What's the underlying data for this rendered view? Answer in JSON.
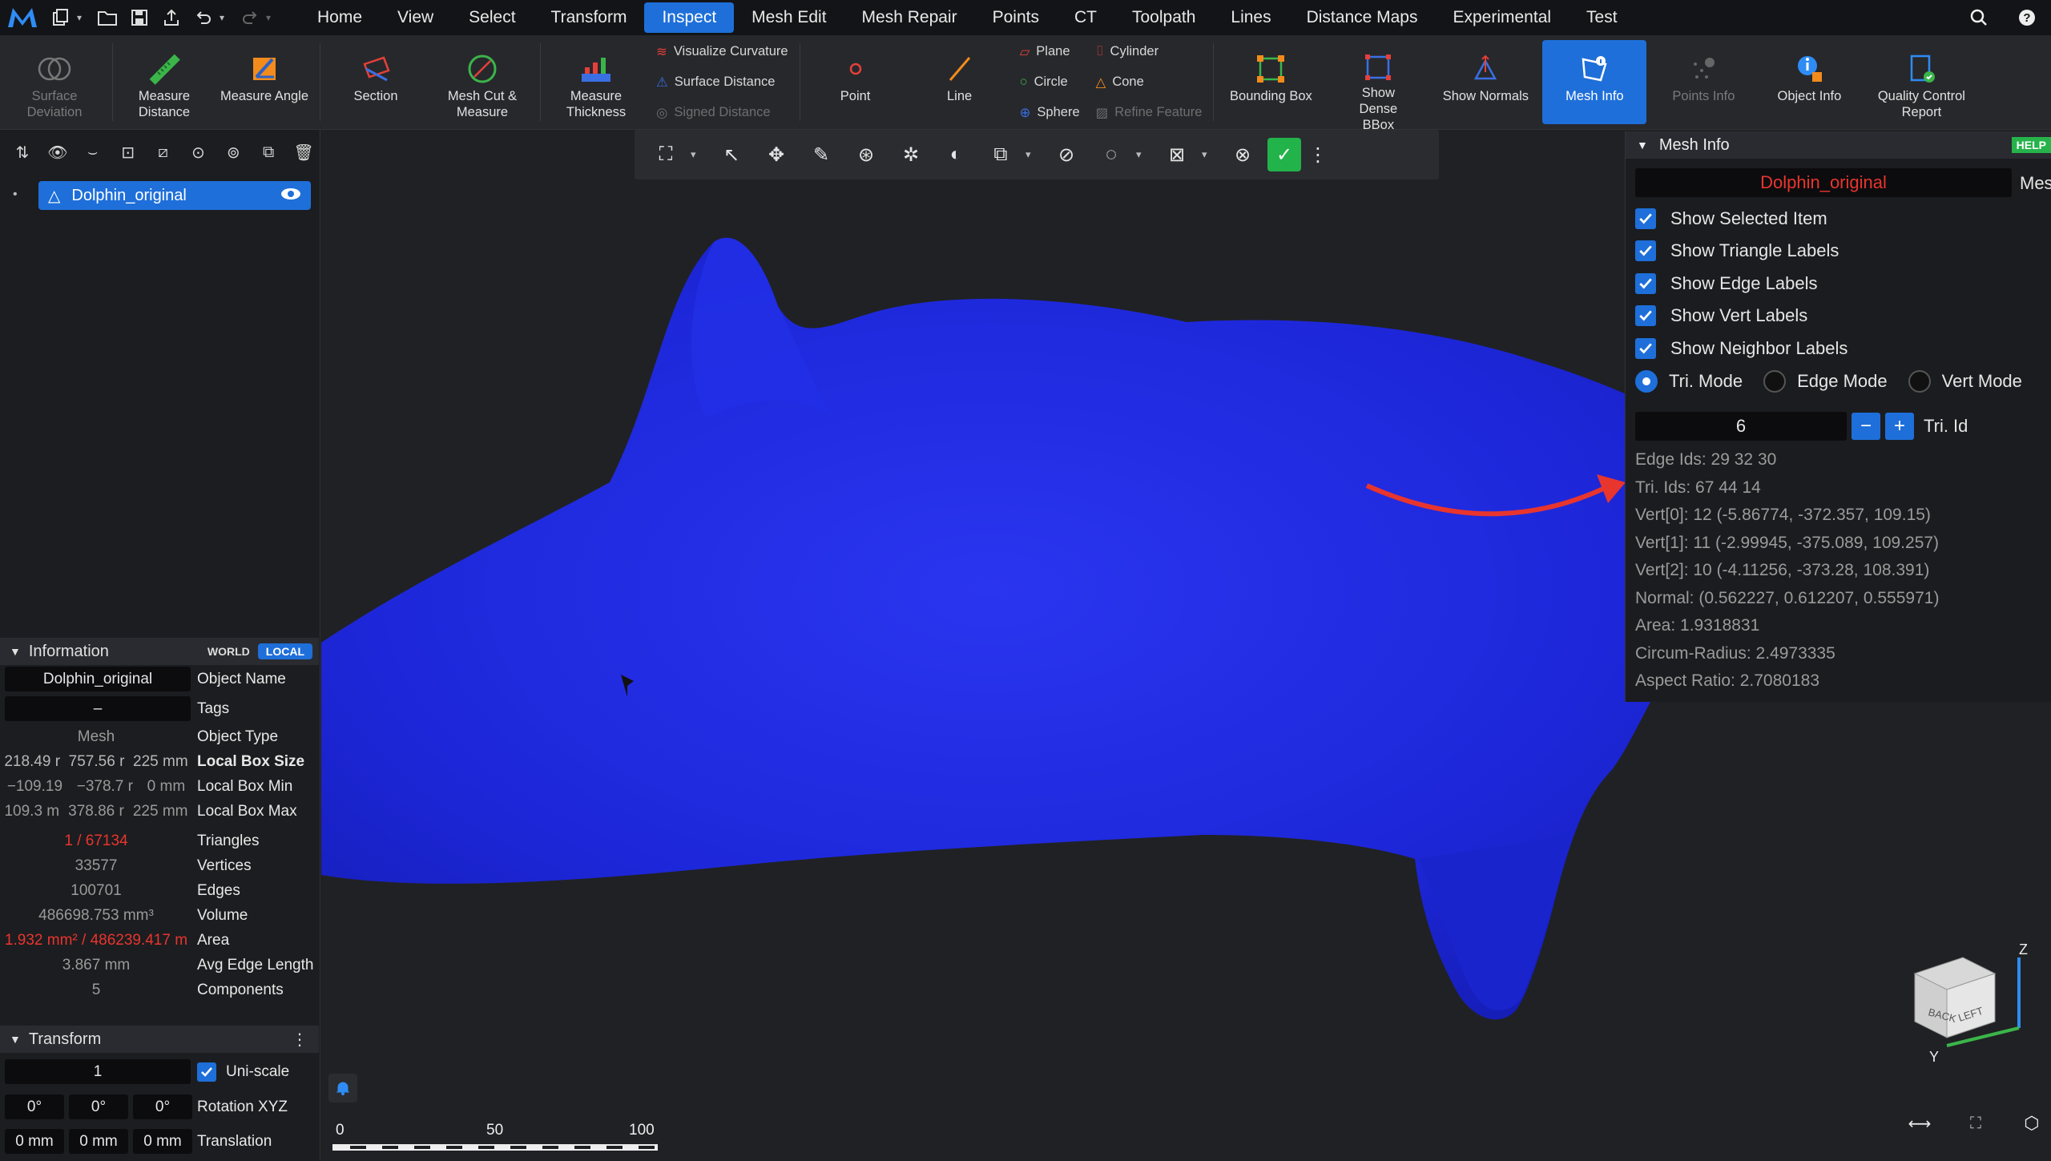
{
  "menubar": {
    "tabs": [
      {
        "label": "Home"
      },
      {
        "label": "View"
      },
      {
        "label": "Select"
      },
      {
        "label": "Transform"
      },
      {
        "label": "Inspect"
      },
      {
        "label": "Mesh Edit"
      },
      {
        "label": "Mesh Repair"
      },
      {
        "label": "Points"
      },
      {
        "label": "CT"
      },
      {
        "label": "Toolpath"
      },
      {
        "label": "Lines"
      },
      {
        "label": "Distance Maps"
      },
      {
        "label": "Experimental"
      },
      {
        "label": "Test"
      }
    ],
    "active_tab": "Inspect"
  },
  "ribbon": {
    "surface_deviation": "Surface Deviation",
    "measure_distance": "Measure Distance",
    "measure_angle": "Measure Angle",
    "section": "Section",
    "mesh_cut": "Mesh Cut & Measure",
    "measure_thickness": "Measure Thickness",
    "visualize_curvature": "Visualize Curvature",
    "surface_distance": "Surface Distance",
    "signed_distance": "Signed Distance",
    "point": "Point",
    "line": "Line",
    "plane": "Plane",
    "circle": "Circle",
    "sphere": "Sphere",
    "cylinder": "Cylinder",
    "cone": "Cone",
    "refine_feature": "Refine Feature",
    "bounding_box": "Bounding Box",
    "show_dense_bbox": "Show Dense BBox",
    "show_normals": "Show Normals",
    "mesh_info": "Mesh Info",
    "points_info": "Points Info",
    "object_info": "Object Info",
    "quality_report": "Quality Control Report"
  },
  "scene_tree": {
    "object_name": "Dolphin_original"
  },
  "information": {
    "title": "Information",
    "world": "WORLD",
    "local": "LOCAL",
    "object_name_value": "Dolphin_original",
    "object_name_label": "Object Name",
    "tags_value": "–",
    "tags_label": "Tags",
    "object_type_value": "Mesh",
    "object_type_label": "Object Type",
    "box_size": [
      "218.49 r",
      "757.56 r",
      "225 mm"
    ],
    "box_size_label": "Local Box Size",
    "box_min": [
      "−109.19",
      "−378.7 r",
      "0 mm"
    ],
    "box_min_label": "Local Box Min",
    "box_max": [
      "109.3 m",
      "378.86 r",
      "225 mm"
    ],
    "box_max_label": "Local Box Max",
    "triangles_value": "1 / 67134",
    "triangles_label": "Triangles",
    "vertices_value": "33577",
    "vertices_label": "Vertices",
    "edges_value": "100701",
    "edges_label": "Edges",
    "volume_value": "486698.753 mm³",
    "volume_label": "Volume",
    "area_value": "1.932 mm² / 486239.417 m",
    "area_label": "Area",
    "avg_edge_value": "3.867 mm",
    "avg_edge_label": "Avg Edge Length",
    "components_value": "5",
    "components_label": "Components"
  },
  "transform": {
    "title": "Transform",
    "scale_value": "1",
    "uniscale_label": "Uni-scale",
    "rotation": [
      "0°",
      "0°",
      "0°"
    ],
    "rotation_label": "Rotation XYZ",
    "translation": [
      "0 mm",
      "0 mm",
      "0 mm"
    ],
    "translation_label": "Translation"
  },
  "scale_bar": {
    "ticks": [
      "0",
      "50",
      "100"
    ]
  },
  "mesh_info": {
    "title": "Mesh Info",
    "help": "HELP",
    "object": "Dolphin_original",
    "object_suffix": "Mes",
    "checkboxes": [
      "Show Selected Item",
      "Show Triangle Labels",
      "Show Edge Labels",
      "Show Vert Labels",
      "Show Neighbor Labels"
    ],
    "modes": [
      "Tri. Mode",
      "Edge Mode",
      "Vert Mode"
    ],
    "selected_mode": "Tri. Mode",
    "tri_id_value": "6",
    "tri_id_label": "Tri. Id",
    "details": [
      "Edge Ids: 29 32 30",
      "Tri. Ids: 67 44 14",
      "Vert[0]: 12 (-5.86774, -372.357, 109.15)",
      "Vert[1]: 11 (-2.99945, -375.089, 109.257)",
      "Vert[2]: 10 (-4.11256, -373.28, 108.391)",
      "Normal: (0.562227, 0.612207, 0.555971)",
      "Area: 1.9318831",
      "Circum-Radius: 2.4973335",
      "Aspect Ratio: 2.7080183"
    ]
  },
  "view_cube": {
    "z": "Z",
    "y": "Y",
    "back": "BACK",
    "left": "LEFT"
  },
  "colors": {
    "accent": "#1e6fd9",
    "mesh": "#1f2ce6",
    "highlight_red": "#e8352e",
    "help_green": "#25b34a"
  }
}
